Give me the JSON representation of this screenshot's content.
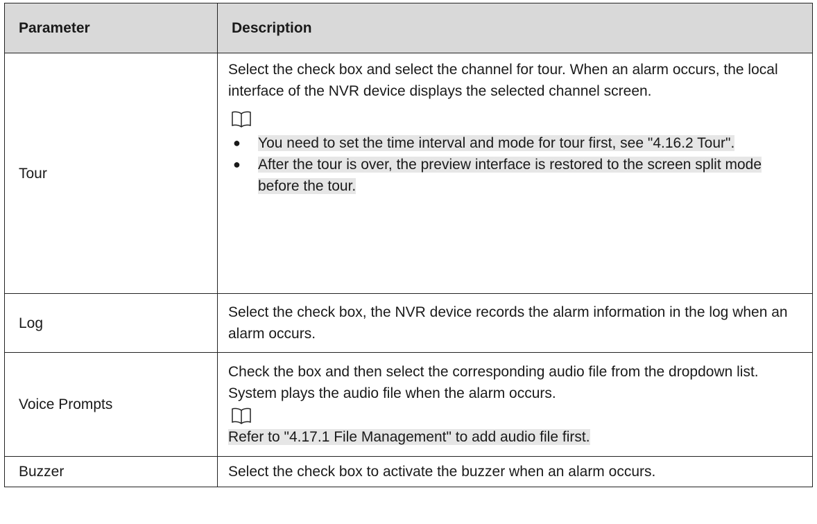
{
  "header": {
    "parameter": "Parameter",
    "description": "Description"
  },
  "rows": [
    {
      "parameter": "Tour",
      "description": "Select the check box and select the channel for tour. When an alarm occurs, the local interface of the NVR device displays the selected channel screen.",
      "note_icon": "book-icon",
      "notes": [
        "You need to set the time interval and mode for tour first, see \"4.16.2 Tour\".",
        "After the tour is over, the preview interface is restored to the screen split mode before the tour."
      ]
    },
    {
      "parameter": "Log",
      "description": "Select the check box, the NVR device records the alarm information in the log when an alarm occurs."
    },
    {
      "parameter": "Voice Prompts",
      "description": "Check the box and then select the corresponding audio file from the dropdown list. System plays the audio file when the alarm occurs.",
      "note_icon": "book-icon",
      "note": "Refer to \"4.17.1 File Management\" to add audio file first."
    },
    {
      "parameter": "Buzzer",
      "description": "Select the check box to activate the buzzer when an alarm occurs."
    }
  ]
}
